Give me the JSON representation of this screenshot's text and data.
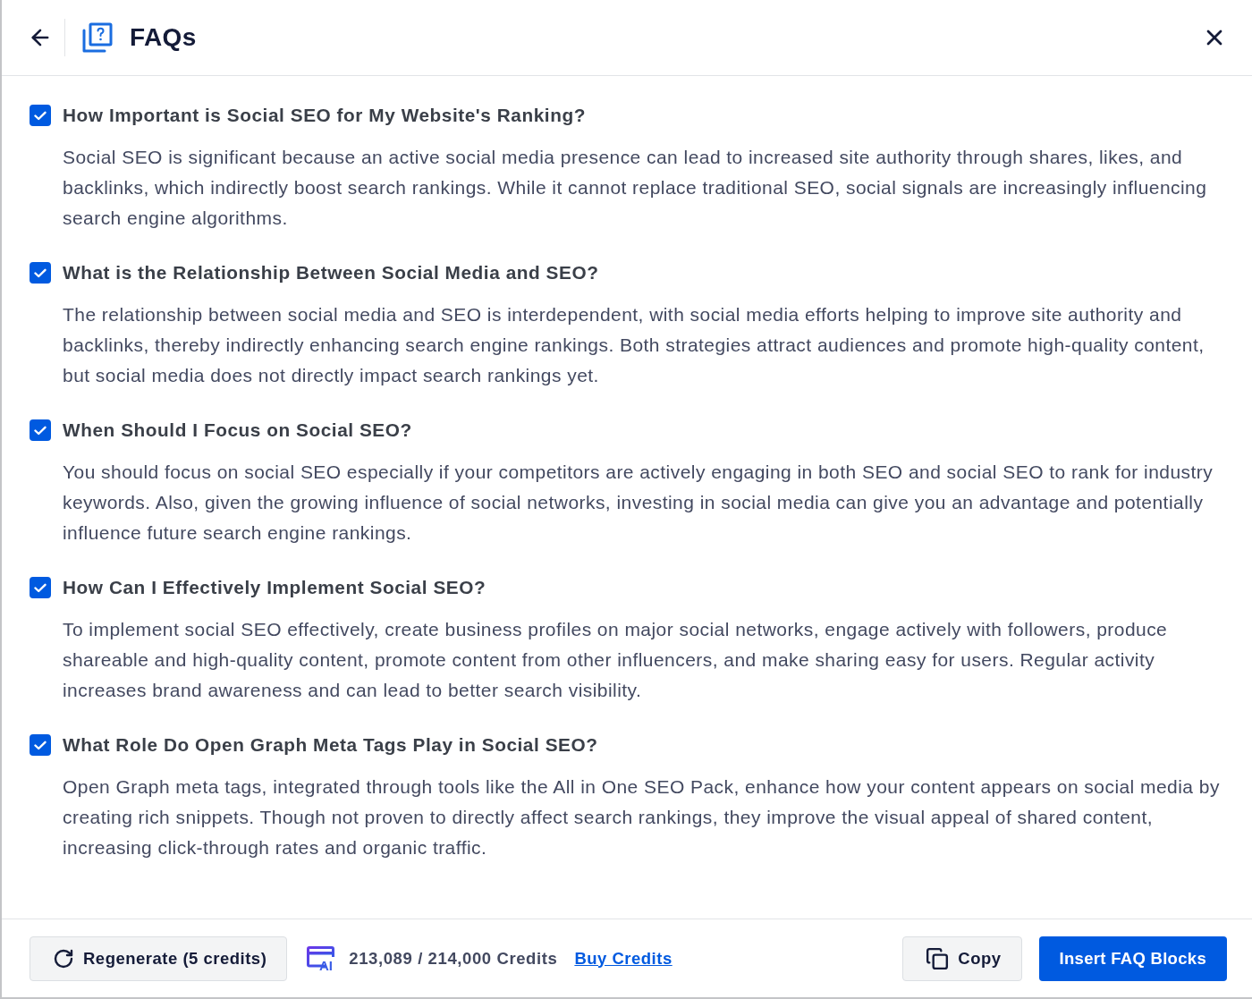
{
  "header": {
    "title": "FAQs"
  },
  "faqs": [
    {
      "checked": true,
      "question": "How Important is Social SEO for My Website's Ranking?",
      "answer": "Social SEO is significant because an active social media presence can lead to increased site authority through shares, likes, and backlinks, which indirectly boost search rankings. While it cannot replace traditional SEO, social signals are increasingly influencing search engine algorithms."
    },
    {
      "checked": true,
      "question": "What is the Relationship Between Social Media and SEO?",
      "answer": "The relationship between social media and SEO is interdependent, with social media efforts helping to improve site authority and backlinks, thereby indirectly enhancing search engine rankings. Both strategies attract audiences and promote high-quality content, but social media does not directly impact search rankings yet."
    },
    {
      "checked": true,
      "question": "When Should I Focus on Social SEO?",
      "answer": "You should focus on social SEO especially if your competitors are actively engaging in both SEO and social SEO to rank for industry keywords. Also, given the growing influence of social networks, investing in social media can give you an advantage and potentially influence future search engine rankings."
    },
    {
      "checked": true,
      "question": "How Can I Effectively Implement Social SEO?",
      "answer": "To implement social SEO effectively, create business profiles on major social networks, engage actively with followers, produce shareable and high-quality content, promote content from other influencers, and make sharing easy for users. Regular activity increases brand awareness and can lead to better search visibility."
    },
    {
      "checked": true,
      "question": "What Role Do Open Graph Meta Tags Play in Social SEO?",
      "answer": "Open Graph meta tags, integrated through tools like the All in One SEO Pack, enhance how your content appears on social media by creating rich snippets. Though not proven to directly affect search rankings, they improve the visual appeal of shared content, increasing click-through rates and organic traffic."
    }
  ],
  "footer": {
    "regenerate_button": "Regenerate (5 credits)",
    "credits": {
      "icon_label": "AI",
      "balance": "213,089 / 214,000 Credits",
      "buy_link": "Buy Credits"
    },
    "copy_button": "Copy",
    "insert_button": "Insert FAQ Blocks"
  }
}
